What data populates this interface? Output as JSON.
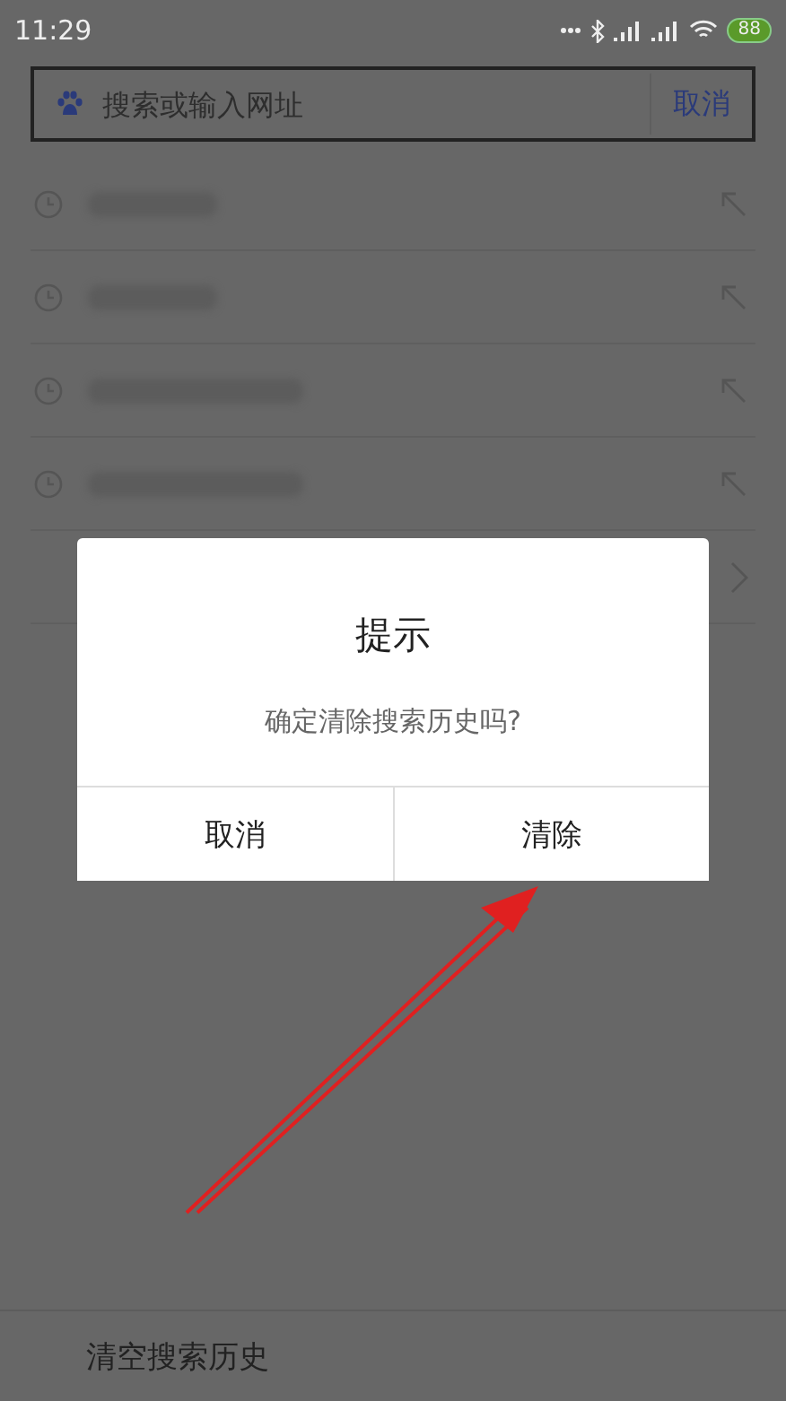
{
  "status_bar": {
    "time": "11:29",
    "battery": "88"
  },
  "search": {
    "placeholder": "搜索或输入网址",
    "cancel": "取消"
  },
  "history": [
    {
      "kind": "recent"
    },
    {
      "kind": "recent"
    },
    {
      "kind": "recent"
    },
    {
      "kind": "recent"
    },
    {
      "kind": "more"
    }
  ],
  "dialog": {
    "title": "提示",
    "message": "确定清除搜索历史吗?",
    "buttons": [
      "取消",
      "清除"
    ]
  },
  "footer": {
    "label": "清空搜索历史"
  }
}
